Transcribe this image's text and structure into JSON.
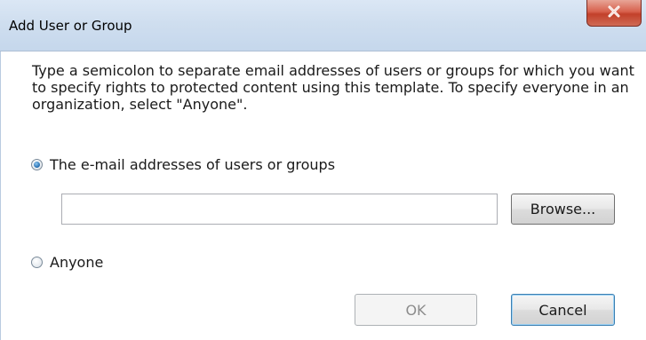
{
  "window": {
    "title": "Add User or Group",
    "close_icon": "close-x"
  },
  "instructions": "Type a semicolon to separate email addresses of users or groups for which you want to specify rights to protected content using this template. To specify everyone in an organization, select \"Anyone\".",
  "options": {
    "email_label": "The e-mail addresses of users or groups",
    "email_selected": true,
    "anyone_label": "Anyone",
    "anyone_selected": false
  },
  "email_input": {
    "value": "",
    "placeholder": ""
  },
  "buttons": {
    "browse": "Browse...",
    "ok": "OK",
    "cancel": "Cancel"
  }
}
